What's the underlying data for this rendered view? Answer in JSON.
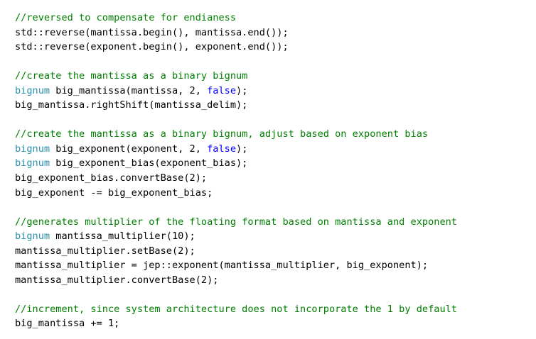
{
  "editor": {
    "lines": [
      [
        {
          "t": "c",
          "s": "//reversed to compensate for endianess"
        }
      ],
      [
        {
          "t": "p",
          "s": "std::reverse(mantissa.begin(), mantissa.end());"
        }
      ],
      [
        {
          "t": "p",
          "s": "std::reverse(exponent.begin(), exponent.end());"
        }
      ],
      [],
      [
        {
          "t": "c",
          "s": "//create the mantissa as a binary bignum"
        }
      ],
      [
        {
          "t": "ty",
          "s": "bignum"
        },
        {
          "t": "p",
          "s": " big_mantissa(mantissa, 2, "
        },
        {
          "t": "k",
          "s": "false"
        },
        {
          "t": "p",
          "s": ");"
        }
      ],
      [
        {
          "t": "p",
          "s": "big_mantissa.rightShift(mantissa_delim);"
        }
      ],
      [],
      [
        {
          "t": "c",
          "s": "//create the mantissa as a binary bignum, adjust based on exponent bias"
        }
      ],
      [
        {
          "t": "ty",
          "s": "bignum"
        },
        {
          "t": "p",
          "s": " big_exponent(exponent, 2, "
        },
        {
          "t": "k",
          "s": "false"
        },
        {
          "t": "p",
          "s": ");"
        }
      ],
      [
        {
          "t": "ty",
          "s": "bignum"
        },
        {
          "t": "p",
          "s": " big_exponent_bias(exponent_bias);"
        }
      ],
      [
        {
          "t": "p",
          "s": "big_exponent_bias.convertBase(2);"
        }
      ],
      [
        {
          "t": "p",
          "s": "big_exponent -= big_exponent_bias;"
        }
      ],
      [],
      [
        {
          "t": "c",
          "s": "//generates multiplier of the floating format based on mantissa and exponent"
        }
      ],
      [
        {
          "t": "ty",
          "s": "bignum"
        },
        {
          "t": "p",
          "s": " mantissa_multiplier(10);"
        }
      ],
      [
        {
          "t": "p",
          "s": "mantissa_multiplier.setBase(2);"
        }
      ],
      [
        {
          "t": "p",
          "s": "mantissa_multiplier = jep::exponent(mantissa_multiplier, big_exponent);"
        }
      ],
      [
        {
          "t": "p",
          "s": "mantissa_multiplier.convertBase(2);"
        }
      ],
      [],
      [
        {
          "t": "c",
          "s": "//increment, since system architecture does not incorporate the 1 by default"
        }
      ],
      [
        {
          "t": "p",
          "s": "big_mantissa += 1;"
        }
      ]
    ]
  },
  "colors": {
    "background": "#ffffff",
    "comment": "#008000",
    "type": "#2b91af",
    "keyword": "#0000ff",
    "plain": "#000000"
  }
}
